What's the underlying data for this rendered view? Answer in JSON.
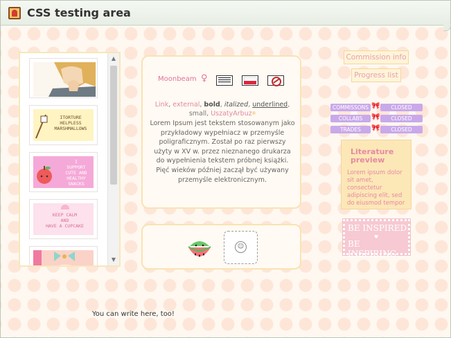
{
  "window": {
    "title": "CSS testing area",
    "icon": "scroll-icon"
  },
  "stamps": [
    {
      "name": "stamp-anime-hands",
      "text": ""
    },
    {
      "name": "stamp-helpless-marshmallows",
      "text": "ITORTURE\nHELPLESS\nMARSHMALLOWS"
    },
    {
      "name": "stamp-support-snacks",
      "text": "I\nSUPPORT\nCUTE AND\nHEALTHY\nSNACKS"
    },
    {
      "name": "stamp-keep-calm",
      "text": "KEEP CALM\nAND\nHAVE A CUPCAKE"
    },
    {
      "name": "stamp-cupcake-bow",
      "text": ""
    }
  ],
  "profile": {
    "name": "Moonbeam",
    "gender_symbol": "♀",
    "links": {
      "link": "Link",
      "external": "external",
      "bold": "bold",
      "italized": "italized",
      "underlined": "underlined",
      "small": "small",
      "user": "UszatyArbuz"
    },
    "lorem": "Lorem Ipsum jest tekstem stosowanym jako przykładowy wypełniacz w przemyśle poligraficznym. Został po raz pierwszy użyty w XV w. przez nieznanego drukarza do wypełnienia tekstem próbnej książki. Pięć wieków później zaczął być używany przemyśle elektronicznym."
  },
  "sidebar": {
    "commission_label": "Commission info",
    "progress_label": "Progress list",
    "statuses": [
      {
        "label": "COMMISSONS",
        "value": "CLOSED"
      },
      {
        "label": "COLLABS",
        "value": "CLOSED"
      },
      {
        "label": "TRADES",
        "value": "CLOSED"
      }
    ],
    "literature": {
      "title": "Literature preview",
      "body": "Lorem ipsum dolor sit amet, consectetur adipiscing elit, sed do eiusmod tempor"
    },
    "inspiring": {
      "line1": "BE INSPIRED",
      "line2": "BE INSPIRING"
    }
  },
  "footer": {
    "text": "You can write here, too!"
  },
  "colors": {
    "pink": "#e0739b",
    "lavender": "#c9a9ea",
    "cream": "#fce7b7"
  }
}
